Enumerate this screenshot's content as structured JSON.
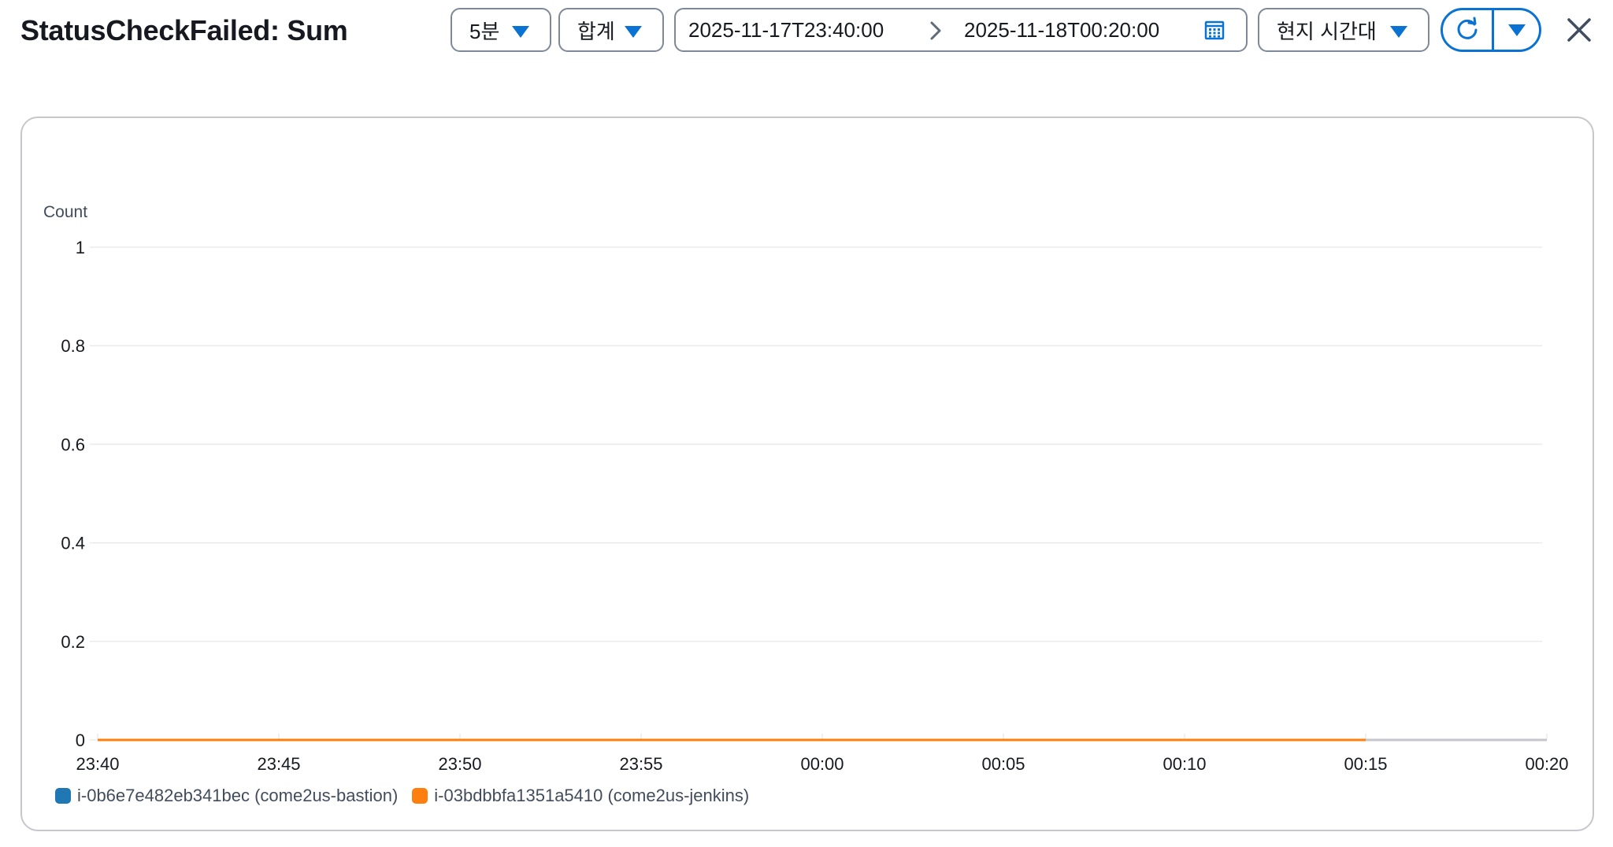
{
  "header": {
    "title": "StatusCheckFailed: Sum",
    "period": "5분",
    "statistic": "합계",
    "range_start": "2025-11-17T23:40:00",
    "range_end": "2025-11-18T00:20:00",
    "timezone": "현지 시간대"
  },
  "icons": {
    "period_caret": "caret-down-icon",
    "stat_caret": "caret-down-icon",
    "range_separator": "chevron-right-icon",
    "calendar": "calendar-icon",
    "timezone_caret": "caret-down-icon",
    "refresh": "refresh-icon",
    "refresh_dropdown": "caret-down-icon",
    "close": "close-icon"
  },
  "colors": {
    "accent": "#0972d3",
    "series_1": "#1f77b4",
    "series_2": "#ff7f0e",
    "grid": "#e9ebed",
    "no_data": "#c6c6cd"
  },
  "chart_data": {
    "type": "line",
    "ylabel": "Count",
    "ylim": [
      0,
      1
    ],
    "yticks": [
      "1",
      "0.8",
      "0.6",
      "0.4",
      "0.2",
      "0"
    ],
    "ytick_values": [
      1,
      0.8,
      0.6,
      0.4,
      0.2,
      0
    ],
    "x": [
      "23:40",
      "23:45",
      "23:50",
      "23:55",
      "00:00",
      "00:05",
      "00:10",
      "00:15",
      "00:20"
    ],
    "series": [
      {
        "name": "i-0b6e7e482eb341bec (come2us-bastion)",
        "color": "#1f77b4",
        "values": [
          0,
          0,
          0,
          0,
          0,
          0,
          0,
          0,
          null
        ]
      },
      {
        "name": "i-03bdbbfa1351a5410 (come2us-jenkins)",
        "color": "#ff7f0e",
        "values": [
          0,
          0,
          0,
          0,
          0,
          0,
          0,
          0,
          null
        ]
      }
    ],
    "grid": true,
    "legend_position": "bottom-left"
  }
}
